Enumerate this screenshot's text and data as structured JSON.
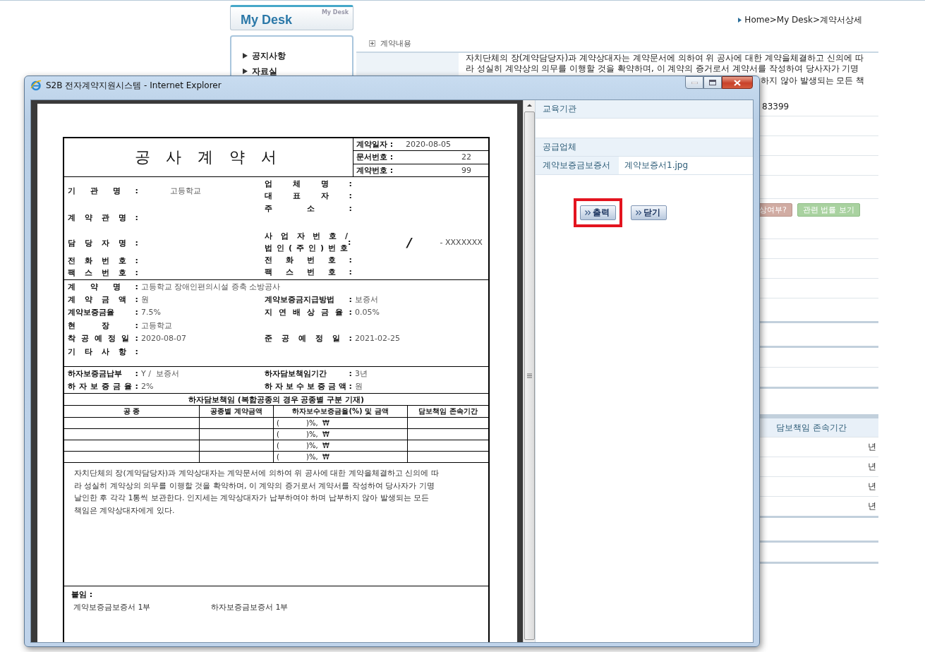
{
  "page": {
    "logo": {
      "title": "My Desk",
      "subtitle": "My Desk"
    },
    "sidebar": {
      "items": [
        {
          "label": "공지사항"
        },
        {
          "label": "자료실"
        }
      ]
    },
    "breadcrumb": "Home>My Desk>계약서상세",
    "section_title": "계약내용",
    "notice": {
      "lines": [
        "자치단체의 장(계약담당자)과 계약상대자는 계약문서에 의하여 위 공사에 대한 계약을체결하고 신의에 따",
        "라 성실히 계약상의 의무를 이행할 것을 확약하며, 이 계약의 증거로서 계약서를 작성하여 당사자가 기명"
      ],
      "tail": "하지 않아 발생되는 모든 책"
    },
    "value_fragment": "83399",
    "buttons": [
      {
        "label": "상여부?",
        "kind": "warning"
      },
      {
        "label": "관련 법률 보기",
        "kind": "info"
      }
    ],
    "period_table": {
      "header": "담보책임 존속기간",
      "rows": [
        "년",
        "년",
        "년",
        "년"
      ]
    }
  },
  "popup": {
    "title": "S2B 전자계약지원시스템 - Internet Explorer",
    "document": {
      "title": "공 사 계 약 서",
      "meta": [
        {
          "label": "계약일자 :",
          "value": "2020-08-05",
          "kind": "date"
        },
        {
          "label": "문서번호 :",
          "value": "22",
          "kind": "number"
        },
        {
          "label": "계약번호 :",
          "value": "99",
          "kind": "number"
        }
      ],
      "parties": {
        "left": [
          {
            "label": "기 관 명 :",
            "value": "고등학교"
          },
          {
            "label": "계 약 관 명 :"
          },
          {
            "label": "담 당 자 명 :"
          },
          {
            "label": "전 화 번 호 :"
          },
          {
            "label": "팩 스 번 호 :"
          }
        ],
        "right": [
          {
            "kind": "single",
            "label": "업 체 명 :"
          },
          {
            "kind": "single",
            "label": "대 표 자 :"
          },
          {
            "kind": "single",
            "label": "주 소 :"
          },
          {
            "kind": "double",
            "label_lines": [
              "사 업 자 번 호 /",
              "법 인 ( 주 인 ) 번 호"
            ],
            "separator": ":",
            "values": [
              "/",
              "- XXXXXXX"
            ]
          },
          {
            "kind": "single",
            "label": "전 화 번 호 :"
          },
          {
            "kind": "single",
            "label": "팩 스 번 호 :"
          }
        ]
      },
      "contract": [
        {
          "left": {
            "label": "계 약 명 :",
            "value": "고등학교 장애인편의시설 증축 소방공사"
          }
        },
        {
          "left": {
            "label": "계 약 금 액 :",
            "value": "원"
          },
          "right": {
            "label": "계약보증금지급방법 :",
            "value": "보증서"
          }
        },
        {
          "left": {
            "label": "계약보증금율 :",
            "value": "7.5%"
          },
          "right": {
            "label": "지 연 배 상 금 율 :",
            "value": "0.05%"
          }
        },
        {
          "left": {
            "label": "현 장 :",
            "value": "고등학교"
          }
        },
        {
          "left": {
            "label": "착 공 예 정 일 :",
            "value": "2020-08-07"
          },
          "right": {
            "label": "준 공 예 정 일 :",
            "value": "2021-02-25"
          }
        },
        {
          "left": {
            "label": "기 타 사 항 :"
          }
        }
      ],
      "defect": [
        {
          "left": {
            "label": "하자보증금납부 :",
            "value": "Y /  보증서"
          },
          "right": {
            "label": "하자담보책임기간 :",
            "value": "3년"
          }
        },
        {
          "left": {
            "label": "하 자 보 증 금 율 :",
            "value": "2%"
          },
          "right": {
            "label": "하 자 보 수 보 증 금 액 :",
            "value": "원"
          }
        }
      ],
      "warranty": {
        "caption": "하자담보책임 (복합공종의 경우 공종별 구분 기재)",
        "columns": [
          "공 종",
          "공종별 계약금액",
          "하자보수보증금율(%) 및 금액",
          "담보책임 존속기간"
        ],
        "rows": [
          {
            "rate": "(            )%,  ₩"
          },
          {
            "rate": "(            )%,  ₩"
          },
          {
            "rate": "(            )%,  ₩"
          },
          {
            "rate": "(            )%,  ₩"
          }
        ]
      },
      "terms": [
        "자치단체의 장(계약담당자)과 계약상대자는 계약문서에 의하여 위 공사에 대한 계약을체결하고 신의에 따",
        "라 성실히 계약상의 의무를 이행할 것을 확약하며, 이 계약의 증거로서 계약서를 작성하여 당사자가 기명",
        "날인한 후 각각 1통씩 보관한다. 인지세는 계약상대자가 납부하여야 하며  납부하지 않아 발생되는 모든",
        "책임은 계약상대자에게 있다."
      ],
      "attachments": {
        "label": "붙임 :",
        "items": [
          "계약보증금보증서 1부",
          "하자보증금보증서 1부"
        ]
      }
    },
    "info_panel": [
      {
        "kind": "heading",
        "label": "교육기관"
      },
      {
        "kind": "blank"
      },
      {
        "kind": "heading",
        "label": "공급업체"
      },
      {
        "kind": "file",
        "label": "계약보증금보증서",
        "value": "계약보증서1.jpg"
      }
    ],
    "actions": [
      {
        "label": "출력",
        "highlighted": true
      },
      {
        "label": "닫기",
        "highlighted": false
      }
    ]
  }
}
